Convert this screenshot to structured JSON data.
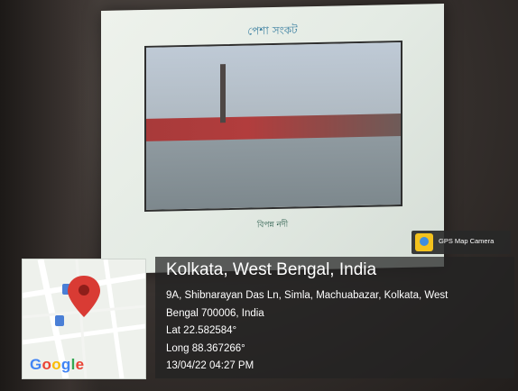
{
  "slide": {
    "heading": "পেশা সংকট",
    "caption": "বিপন্ন নদী"
  },
  "map": {
    "logo": "Google",
    "pin_icon": "map-pin-icon",
    "colors": {
      "pin": "#d93b34",
      "roads": "#ffffff",
      "land": "#eef1ec",
      "poi": "#4a7fd6"
    }
  },
  "location": {
    "title": "Kolkata, West Bengal, India",
    "address_line1": "9A, Shibnarayan Das Ln, Simla, Machuabazar, Kolkata, West",
    "address_line2": "Bengal 700006, India",
    "lat": "Lat 22.582584°",
    "long": "Long 88.367266°",
    "timestamp": "13/04/22 04:27 PM"
  },
  "badge": {
    "label": "GPS Map Camera",
    "icon": "gps-map-camera-icon"
  }
}
